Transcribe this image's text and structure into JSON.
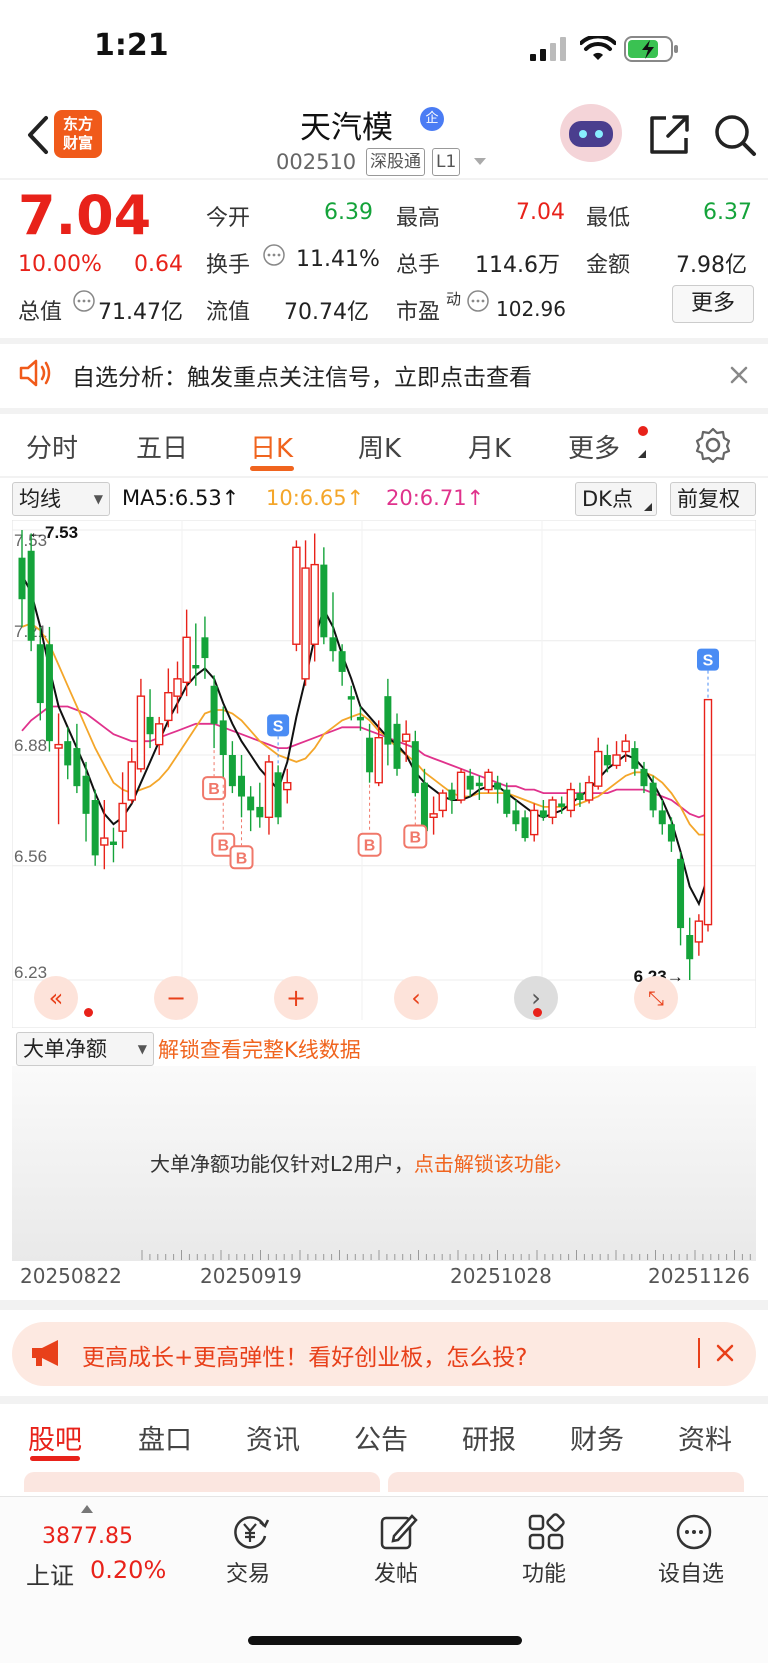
{
  "status": {
    "time": "1:21"
  },
  "header": {
    "logo_text_1": "东方",
    "logo_text_2": "财富",
    "name": "天汽模",
    "badge": "企",
    "code": "002510",
    "tag1": "深股通",
    "tag2": "L1"
  },
  "quote": {
    "price": "7.04",
    "pct": "10.00%",
    "change": "0.64",
    "open_label": "今开",
    "open": "6.39",
    "high_label": "最高",
    "high": "7.04",
    "low_label": "最低",
    "low": "6.37",
    "turnover_label": "换手",
    "turnover": "11.41%",
    "volume_label": "总手",
    "volume": "114.6万",
    "amount_label": "金额",
    "amount": "7.98亿",
    "mcap_label": "总值",
    "mcap": "71.47亿",
    "float_label": "流值",
    "float": "70.74亿",
    "pe_label": "市盈",
    "pe_sup": "动",
    "pe": "102.96",
    "more": "更多"
  },
  "notice": {
    "text": "自选分析：触发重点关注信号，立即点击查看"
  },
  "tabs": [
    {
      "label": "分时"
    },
    {
      "label": "五日"
    },
    {
      "label": "日K"
    },
    {
      "label": "周K"
    },
    {
      "label": "月K"
    },
    {
      "label": "更多"
    }
  ],
  "ma": {
    "select": "均线",
    "ma5": "MA5:6.53↑",
    "ma10": "10:6.65↑",
    "ma20": "20:6.71↑",
    "dk": "DK点",
    "adj": "前复权"
  },
  "colors": {
    "up": "#e8221a",
    "down": "#14a33a",
    "ma5": "#111111",
    "ma10": "#f4a62a",
    "ma20": "#e0328c",
    "accent": "#f0641e"
  },
  "chart_data": {
    "type": "candlestick",
    "y_ticks": [
      "7.53",
      "7.21",
      "6.88",
      "6.56",
      "6.23"
    ],
    "ylim": [
      6.23,
      7.53
    ],
    "high_marker": "7.53",
    "low_marker": "6.23",
    "x_ticks": [
      "20250822",
      "20250919",
      "20251028",
      "20251126"
    ],
    "candles": [
      [
        7.45,
        7.33,
        7.53,
        7.25
      ],
      [
        7.47,
        7.21,
        7.52,
        7.18
      ],
      [
        7.2,
        7.03,
        7.25,
        6.98
      ],
      [
        7.2,
        6.92,
        7.25,
        6.89
      ],
      [
        6.9,
        6.91,
        7.0,
        6.68
      ],
      [
        6.92,
        6.85,
        6.96,
        6.81
      ],
      [
        6.9,
        6.79,
        6.97,
        6.77
      ],
      [
        6.82,
        6.71,
        6.86,
        6.63
      ],
      [
        6.75,
        6.59,
        6.78,
        6.56
      ],
      [
        6.62,
        6.64,
        6.75,
        6.55
      ],
      [
        6.63,
        6.62,
        6.67,
        6.57
      ],
      [
        6.66,
        6.74,
        6.83,
        6.61
      ],
      [
        6.75,
        6.86,
        6.9,
        6.74
      ],
      [
        6.84,
        7.05,
        7.1,
        6.83
      ],
      [
        6.99,
        6.94,
        7.07,
        6.9
      ],
      [
        6.91,
        6.97,
        6.99,
        6.88
      ],
      [
        6.98,
        7.06,
        7.13,
        6.96
      ],
      [
        7.05,
        7.1,
        7.15,
        7.0
      ],
      [
        7.09,
        7.22,
        7.3,
        7.05
      ],
      [
        7.14,
        7.13,
        7.26,
        7.08
      ],
      [
        7.22,
        7.16,
        7.28,
        7.1
      ],
      [
        7.08,
        6.97,
        7.11,
        6.9
      ],
      [
        6.98,
        6.88,
        7.02,
        6.8
      ],
      [
        6.88,
        6.79,
        6.92,
        6.77
      ],
      [
        6.82,
        6.76,
        6.88,
        6.7
      ],
      [
        6.76,
        6.72,
        6.79,
        6.66
      ],
      [
        6.73,
        6.7,
        6.8,
        6.67
      ],
      [
        6.7,
        6.86,
        6.88,
        6.65
      ],
      [
        6.83,
        6.7,
        6.85,
        6.68
      ],
      [
        6.78,
        6.8,
        6.84,
        6.74
      ],
      [
        7.2,
        7.48,
        7.5,
        7.18
      ],
      [
        7.1,
        7.42,
        7.5,
        7.08
      ],
      [
        7.2,
        7.43,
        7.52,
        7.15
      ],
      [
        7.43,
        7.22,
        7.48,
        7.2
      ],
      [
        7.22,
        7.18,
        7.35,
        7.15
      ],
      [
        7.18,
        7.12,
        7.2,
        7.08
      ],
      [
        7.05,
        7.04,
        7.08,
        6.98
      ],
      [
        6.99,
        6.98,
        7.02,
        6.95
      ],
      [
        6.93,
        6.83,
        6.97,
        6.8
      ],
      [
        6.8,
        6.93,
        6.98,
        6.79
      ],
      [
        7.05,
        6.91,
        7.1,
        6.85
      ],
      [
        6.97,
        6.84,
        7.0,
        6.82
      ],
      [
        6.92,
        6.94,
        6.98,
        6.86
      ],
      [
        6.92,
        6.77,
        6.95,
        6.76
      ],
      [
        6.8,
        6.66,
        6.84,
        6.62
      ],
      [
        6.7,
        6.71,
        6.76,
        6.65
      ],
      [
        6.72,
        6.77,
        6.78,
        6.7
      ],
      [
        6.78,
        6.75,
        6.8,
        6.71
      ],
      [
        6.75,
        6.83,
        6.84,
        6.74
      ],
      [
        6.82,
        6.78,
        6.84,
        6.76
      ],
      [
        6.8,
        6.79,
        6.82,
        6.75
      ],
      [
        6.78,
        6.83,
        6.84,
        6.77
      ],
      [
        6.8,
        6.78,
        6.82,
        6.74
      ],
      [
        6.78,
        6.71,
        6.8,
        6.7
      ],
      [
        6.72,
        6.68,
        6.75,
        6.66
      ],
      [
        6.7,
        6.64,
        6.72,
        6.63
      ],
      [
        6.65,
        6.72,
        6.74,
        6.63
      ],
      [
        6.72,
        6.7,
        6.75,
        6.69
      ],
      [
        6.7,
        6.75,
        6.76,
        6.68
      ],
      [
        6.74,
        6.73,
        6.76,
        6.71
      ],
      [
        6.72,
        6.78,
        6.8,
        6.7
      ],
      [
        6.77,
        6.75,
        6.8,
        6.73
      ],
      [
        6.75,
        6.8,
        6.82,
        6.74
      ],
      [
        6.79,
        6.89,
        6.93,
        6.78
      ],
      [
        6.88,
        6.85,
        6.91,
        6.83
      ],
      [
        6.85,
        6.88,
        6.92,
        6.84
      ],
      [
        6.89,
        6.92,
        6.94,
        6.86
      ],
      [
        6.9,
        6.84,
        6.92,
        6.82
      ],
      [
        6.84,
        6.79,
        6.86,
        6.77
      ],
      [
        6.8,
        6.72,
        6.82,
        6.7
      ],
      [
        6.72,
        6.68,
        6.75,
        6.65
      ],
      [
        6.68,
        6.63,
        6.7,
        6.6
      ],
      [
        6.58,
        6.38,
        6.6,
        6.33
      ],
      [
        6.36,
        6.29,
        6.41,
        6.23
      ],
      [
        6.34,
        6.4,
        6.42,
        6.3
      ],
      [
        6.39,
        7.04,
        7.04,
        6.37
      ]
    ],
    "ma5": [
      7.4,
      7.35,
      7.25,
      7.13,
      7.02,
      6.96,
      6.9,
      6.84,
      6.77,
      6.71,
      6.68,
      6.7,
      6.74,
      6.8,
      6.86,
      6.92,
      6.98,
      7.03,
      7.08,
      7.11,
      7.13,
      7.1,
      7.03,
      6.97,
      6.92,
      6.88,
      6.84,
      6.81,
      6.78,
      6.86,
      6.99,
      7.1,
      7.22,
      7.3,
      7.25,
      7.17,
      7.1,
      7.02,
      6.99,
      6.96,
      6.93,
      6.91,
      6.88,
      6.83,
      6.8,
      6.78,
      6.76,
      6.75,
      6.75,
      6.76,
      6.78,
      6.79,
      6.79,
      6.77,
      6.75,
      6.73,
      6.71,
      6.7,
      6.71,
      6.72,
      6.74,
      6.76,
      6.78,
      6.81,
      6.84,
      6.86,
      6.88,
      6.87,
      6.84,
      6.8,
      6.75,
      6.69,
      6.6,
      6.5,
      6.45,
      6.53
    ],
    "ma10": [
      7.25,
      7.26,
      7.24,
      7.2,
      7.14,
      7.08,
      7.02,
      6.96,
      6.9,
      6.85,
      6.8,
      6.78,
      6.77,
      6.78,
      6.79,
      6.81,
      6.84,
      6.88,
      6.92,
      6.96,
      7.0,
      7.01,
      7.01,
      7.0,
      6.98,
      6.95,
      6.92,
      6.9,
      6.88,
      6.87,
      6.86,
      6.87,
      6.9,
      6.94,
      6.96,
      6.98,
      6.99,
      7.0,
      6.98,
      6.95,
      6.93,
      6.9,
      6.88,
      6.86,
      6.83,
      6.81,
      6.79,
      6.77,
      6.76,
      6.76,
      6.77,
      6.77,
      6.77,
      6.77,
      6.76,
      6.75,
      6.74,
      6.73,
      6.73,
      6.73,
      6.73,
      6.74,
      6.75,
      6.76,
      6.78,
      6.8,
      6.82,
      6.83,
      6.83,
      6.82,
      6.8,
      6.77,
      6.73,
      6.68,
      6.65,
      6.65
    ],
    "ma20": [
      6.95,
      6.98,
      7.0,
      7.02,
      7.02,
      7.02,
      7.01,
      7.0,
      6.98,
      6.96,
      6.94,
      6.93,
      6.92,
      6.92,
      6.92,
      6.93,
      6.94,
      6.95,
      6.96,
      6.97,
      6.97,
      6.97,
      6.96,
      6.95,
      6.94,
      6.93,
      6.92,
      6.91,
      6.9,
      6.9,
      6.91,
      6.92,
      6.93,
      6.94,
      6.95,
      6.96,
      6.96,
      6.96,
      6.95,
      6.94,
      6.93,
      6.92,
      6.91,
      6.9,
      6.88,
      6.87,
      6.86,
      6.85,
      6.84,
      6.83,
      6.82,
      6.81,
      6.8,
      6.79,
      6.79,
      6.78,
      6.78,
      6.77,
      6.77,
      6.77,
      6.77,
      6.77,
      6.77,
      6.77,
      6.77,
      6.78,
      6.78,
      6.78,
      6.78,
      6.77,
      6.76,
      6.75,
      6.73,
      6.71,
      6.7,
      6.71
    ],
    "signals": [
      {
        "index": 21,
        "label": "B"
      },
      {
        "index": 22,
        "label": "B"
      },
      {
        "index": 24,
        "label": "B"
      },
      {
        "index": 38,
        "label": "B"
      },
      {
        "index": 43,
        "label": "B"
      },
      {
        "index": 28,
        "label": "S"
      },
      {
        "index": 75,
        "label": "S"
      }
    ]
  },
  "lower": {
    "select": "大单净额",
    "unlock": "解锁查看完整K线数据",
    "msg": "大单净额功能仅针对L2用户，",
    "msg_link": "点击解锁该功能›"
  },
  "banner": {
    "text": "更高成长+更高弹性！看好创业板，怎么投?"
  },
  "bottom_tabs": [
    {
      "label": "股吧"
    },
    {
      "label": "盘口"
    },
    {
      "label": "资讯"
    },
    {
      "label": "公告"
    },
    {
      "label": "研报"
    },
    {
      "label": "财务"
    },
    {
      "label": "资料"
    }
  ],
  "index_quote": {
    "value": "3877.85",
    "name": "上证",
    "pct": "0.20%"
  },
  "nav": [
    {
      "label": "交易",
      "icon": "yen-cycle-icon"
    },
    {
      "label": "发帖",
      "icon": "edit-icon"
    },
    {
      "label": "功能",
      "icon": "grid-icon"
    },
    {
      "label": "设自选",
      "icon": "more-dots-icon"
    }
  ]
}
